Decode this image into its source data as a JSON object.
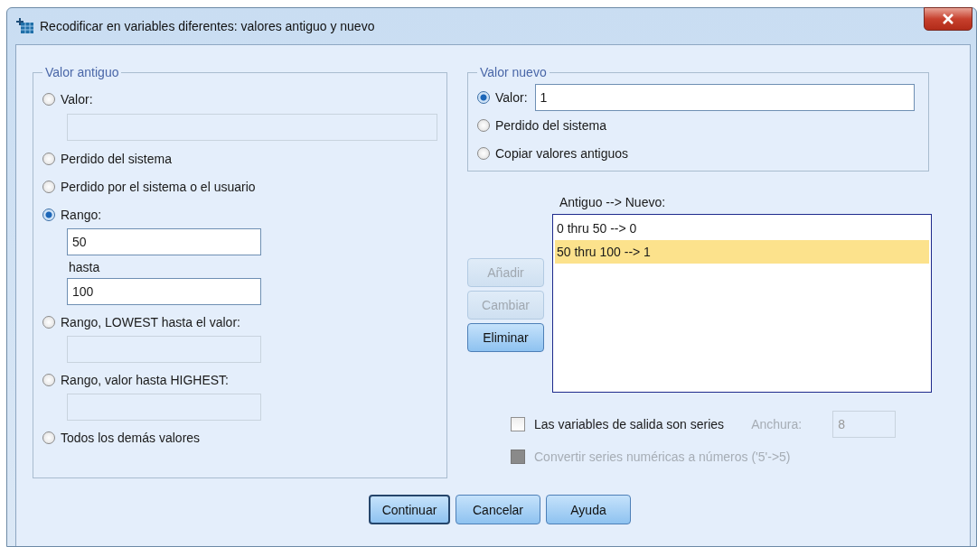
{
  "window": {
    "title": "Recodificar en variables diferentes: valores antiguo y nuevo"
  },
  "old_value": {
    "legend": "Valor antiguo",
    "options": [
      {
        "label": "Valor:",
        "selected": false,
        "inputs": [
          {
            "disabled": true,
            "kind": "wide"
          }
        ]
      },
      {
        "label": "Perdido del sistema",
        "selected": false
      },
      {
        "label": "Perdido por el sistema o el usuario",
        "selected": false
      },
      {
        "label": "Rango:",
        "selected": true,
        "inputs": [
          {
            "value": "50",
            "disabled": false,
            "kind": "short"
          },
          {
            "value": "100",
            "disabled": false,
            "kind": "short"
          }
        ],
        "between_label": "hasta"
      },
      {
        "label": "Rango, LOWEST hasta el valor:",
        "selected": false,
        "inputs": [
          {
            "disabled": true,
            "kind": "short"
          }
        ]
      },
      {
        "label": "Rango, valor hasta HIGHEST:",
        "selected": false,
        "inputs": [
          {
            "disabled": true,
            "kind": "short"
          }
        ]
      },
      {
        "label": "Todos los demás valores",
        "selected": false
      }
    ]
  },
  "new_value": {
    "legend": "Valor nuevo",
    "options": [
      {
        "label": "Valor:",
        "selected": true,
        "input": {
          "value": "1"
        }
      },
      {
        "label": "Perdido del sistema",
        "selected": false
      },
      {
        "label": "Copiar valores antiguos",
        "selected": false
      }
    ]
  },
  "mapping": {
    "label": "Antiguo --> Nuevo:",
    "rows": [
      {
        "text": "0 thru 50 --> 0",
        "selected": false
      },
      {
        "text": "50 thru 100 --> 1",
        "selected": true
      }
    ]
  },
  "list_buttons": [
    {
      "label": "Añadir",
      "disabled": true
    },
    {
      "label": "Cambiar",
      "disabled": true
    },
    {
      "label": "Eliminar",
      "disabled": false
    }
  ],
  "options": [
    {
      "label": "Las variables de salida son series",
      "checked": false,
      "disabled": false
    },
    {
      "label": "Convertir series numéricas a números ('5'->5)",
      "checked": false,
      "disabled": true
    }
  ],
  "width_field": {
    "label": "Anchura:",
    "value": "8",
    "disabled": true
  },
  "buttons": [
    {
      "label": "Continuar",
      "default": true
    },
    {
      "label": "Cancelar",
      "default": false
    },
    {
      "label": "Ayuda",
      "default": false
    }
  ]
}
